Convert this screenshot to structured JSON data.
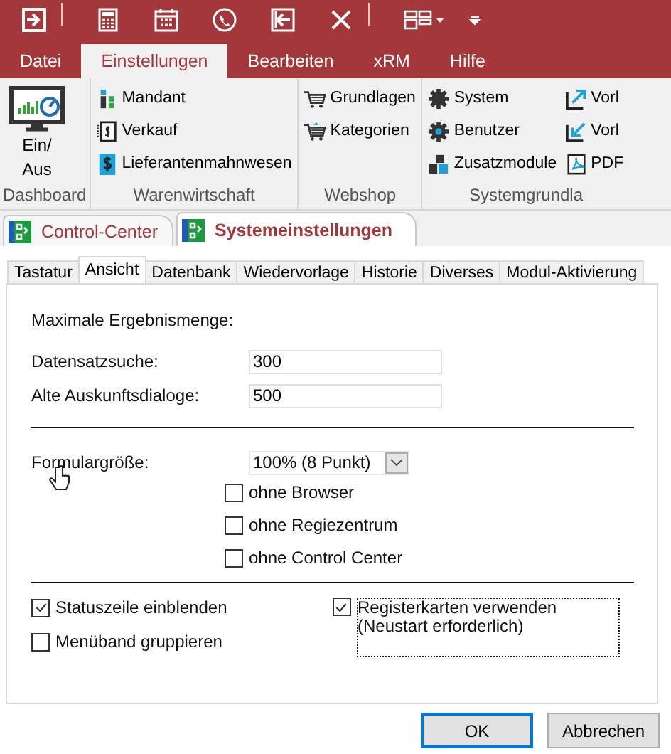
{
  "ribbon_tabs": [
    {
      "label": "Datei",
      "selected": false
    },
    {
      "label": "Einstellungen",
      "selected": true
    },
    {
      "label": "Bearbeiten",
      "selected": false
    },
    {
      "label": "xRM",
      "selected": false
    },
    {
      "label": "Hilfe",
      "selected": false
    }
  ],
  "ribbon_groups": [
    {
      "label": "Dashboard",
      "columns": [
        [
          {
            "label": "Ein/\nAus",
            "kind": "large"
          }
        ]
      ]
    },
    {
      "label": "Warenwirtschaft",
      "columns": [
        [
          {
            "label": "Mandant",
            "kind": "small"
          },
          {
            "label": "Verkauf",
            "kind": "small"
          },
          {
            "label": "Lieferantenmahnwesen",
            "kind": "small"
          }
        ]
      ]
    },
    {
      "label": "Webshop",
      "columns": [
        [
          {
            "label": "Grundlagen",
            "kind": "small"
          },
          {
            "label": "Kategorien",
            "kind": "small"
          }
        ]
      ]
    },
    {
      "label": "Systemgrundla",
      "columns": [
        [
          {
            "label": "System",
            "kind": "small"
          },
          {
            "label": "Benutzer",
            "kind": "small"
          },
          {
            "label": "Zusatzmodule",
            "kind": "small"
          }
        ],
        [
          {
            "label": "Vorl",
            "kind": "small"
          },
          {
            "label": "Vorl",
            "kind": "small"
          },
          {
            "label": "PDF",
            "kind": "small"
          }
        ]
      ]
    }
  ],
  "document_tabs": [
    {
      "label": "Control-Center",
      "selected": false
    },
    {
      "label": "Systemeinstellungen",
      "selected": true
    }
  ],
  "settings_tabs": [
    {
      "label": "Tastatur",
      "selected": false
    },
    {
      "label": "Ansicht",
      "selected": true
    },
    {
      "label": "Datenbank",
      "selected": false
    },
    {
      "label": "Wiedervorlage",
      "selected": false
    },
    {
      "label": "Historie",
      "selected": false
    },
    {
      "label": "Diverses",
      "selected": false
    },
    {
      "label": "Modul-Aktivierung",
      "selected": false
    }
  ],
  "section_heading": "Maximale Ergebnismenge:",
  "fields": [
    {
      "label": "Datensatzsuche:",
      "value": "300"
    },
    {
      "label": "Alte Auskunftsdialoge:",
      "value": "500"
    }
  ],
  "form_size": {
    "label": "Formulargröße:",
    "value": "100% (8 Punkt)"
  },
  "form_options": [
    {
      "label": "ohne Browser",
      "checked": false
    },
    {
      "label": "ohne Regiezentrum",
      "checked": false
    },
    {
      "label": "ohne Control Center",
      "checked": false
    }
  ],
  "left_options": [
    {
      "label": "Statuszeile einblenden",
      "checked": true
    },
    {
      "label": "Menüband gruppieren",
      "checked": false
    }
  ],
  "right_options": [
    {
      "label": "Registerkarten verwenden\n(Neustart erforderlich)",
      "checked": true,
      "focused": true
    }
  ],
  "buttons": [
    {
      "label": "OK",
      "default": true
    },
    {
      "label": "Abbrechen",
      "default": false
    }
  ]
}
